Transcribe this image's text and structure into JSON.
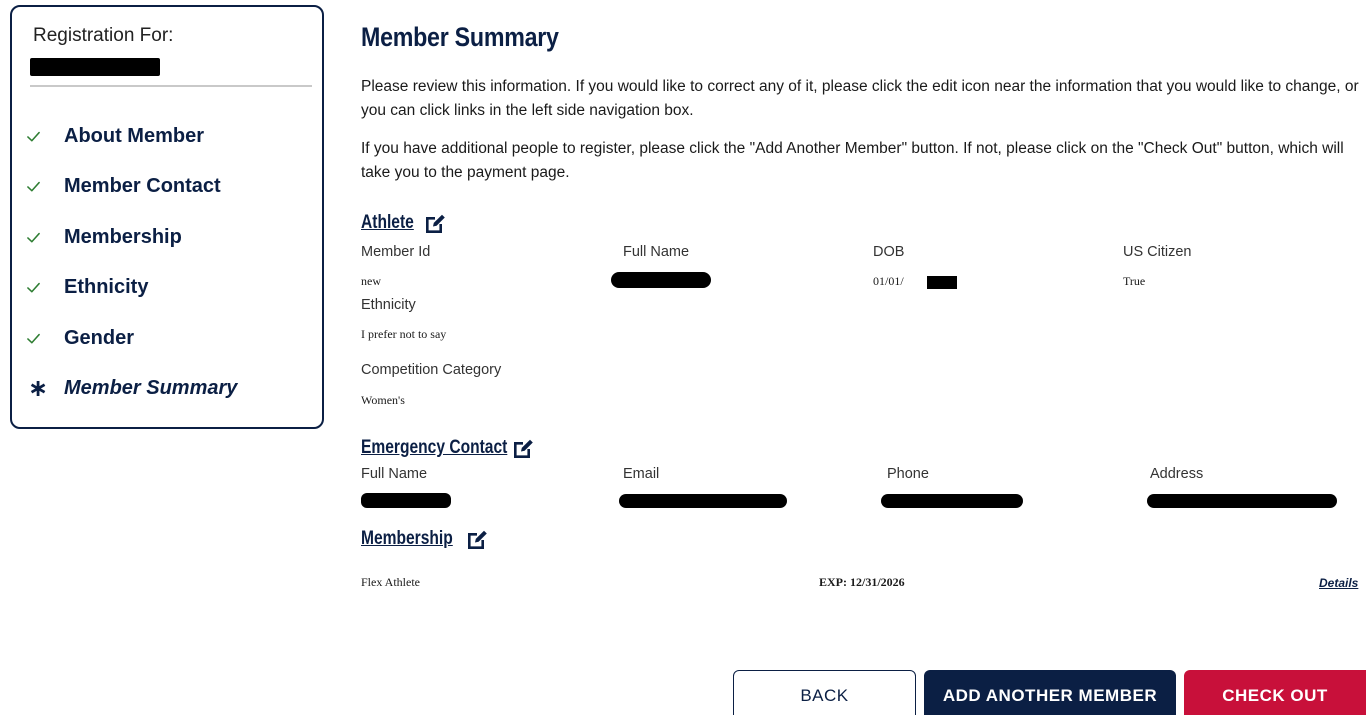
{
  "sidebar": {
    "registration_for_label": "Registration For:",
    "items": [
      {
        "label": "About Member",
        "status": "done"
      },
      {
        "label": "Member Contact",
        "status": "done"
      },
      {
        "label": "Membership",
        "status": "done"
      },
      {
        "label": "Ethnicity",
        "status": "done"
      },
      {
        "label": "Gender",
        "status": "done"
      },
      {
        "label": "Member Summary",
        "status": "current"
      }
    ]
  },
  "main": {
    "title": "Member Summary",
    "intro_1": "Please review this information. If you would like to correct any of it, please click the edit icon near the information that you would like to change, or you can click links in the left side navigation box.",
    "intro_2": "If you have additional people to register, please click the \"Add Another Member\" button. If not, please click on the \"Check Out\" button, which will take you to the payment page.",
    "athlete": {
      "heading": "Athlete",
      "member_id_label": "Member Id",
      "member_id_value": "new",
      "full_name_label": "Full Name",
      "dob_label": "DOB",
      "dob_value": "01/01/",
      "us_citizen_label": "US Citizen",
      "us_citizen_value": "True",
      "ethnicity_label": "Ethnicity",
      "ethnicity_value": "I prefer not to say",
      "competition_label": "Competition Category",
      "competition_value": "Women's"
    },
    "emergency": {
      "heading": "Emergency Contact",
      "full_name_label": "Full Name",
      "email_label": "Email",
      "phone_label": "Phone",
      "address_label": "Address"
    },
    "membership": {
      "heading": "Membership",
      "type_value": "Flex Athlete",
      "expiration": "EXP: 12/31/2026",
      "details_link": "Details"
    }
  },
  "buttons": {
    "back": "BACK",
    "add_another": "ADD ANOTHER MEMBER",
    "checkout": "CHECK OUT"
  },
  "colors": {
    "navy": "#0b1f44",
    "check_green": "#2e7d32",
    "checkout_red": "#c8103a"
  }
}
